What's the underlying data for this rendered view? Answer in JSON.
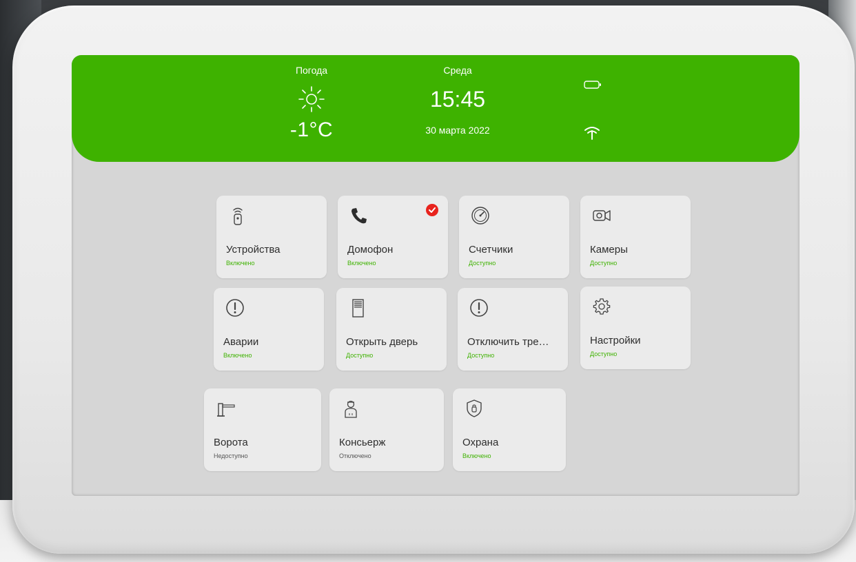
{
  "header": {
    "weather_label": "Погода",
    "weather_icon": "sun-icon",
    "temperature": "-1°C",
    "day": "Среда",
    "time": "15:45",
    "date": "30 марта 2022",
    "battery_icon": "battery-icon",
    "wifi_icon": "wifi-icon",
    "accent_color": "#3eb200"
  },
  "tiles": [
    {
      "title": "Устройства",
      "status": "Включено",
      "icon": "remote-icon",
      "status_color": "#3eb200"
    },
    {
      "title": "Домофон",
      "status": "Включено",
      "icon": "phone-icon",
      "badge": "check-badge",
      "status_color": "#3eb200"
    },
    {
      "title": "Счетчики",
      "status": "Доступно",
      "icon": "meter-icon",
      "status_color": "#3eb200"
    },
    {
      "title": "Камеры",
      "status": "Доступно",
      "icon": "camera-icon",
      "status_color": "#3eb200"
    },
    {
      "title": "Аварии",
      "status": "Включено",
      "icon": "alert-icon",
      "status_color": "#3eb200"
    },
    {
      "title": "Открыть дверь",
      "status": "Доступно",
      "icon": "door-icon",
      "status_color": "#3eb200"
    },
    {
      "title": "Отключить тре…",
      "status": "Доступно",
      "icon": "alert-icon",
      "status_color": "#3eb200"
    },
    {
      "title": "Настройки",
      "status": "Доступно",
      "icon": "gear-icon",
      "status_color": "#3eb200"
    },
    {
      "title": "Ворота",
      "status": "Недоступно",
      "icon": "barrier-icon",
      "status_color": "#555555"
    },
    {
      "title": "Консьерж",
      "status": "Отключено",
      "icon": "concierge-icon",
      "status_color": "#555555"
    },
    {
      "title": "Охрана",
      "status": "Включено",
      "icon": "shield-icon",
      "status_color": "#3eb200"
    }
  ]
}
